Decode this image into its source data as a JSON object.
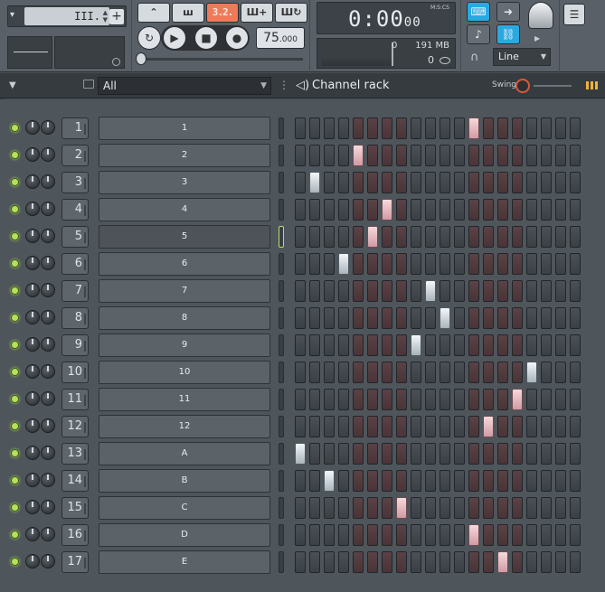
{
  "toolbar": {
    "pattern": {
      "label": "III.",
      "add_symbol": "+"
    },
    "transport": {
      "countdown_label": "3.2.",
      "tempo_int": "75",
      "tempo_dec": ".000"
    },
    "time": {
      "main": "0:00",
      "sub": "00",
      "unit": "M:S:CS"
    },
    "cpu": {
      "cpu_value": "0",
      "memory": "191 MB",
      "polyphony": "0"
    },
    "snap": {
      "value": "Line"
    }
  },
  "rack": {
    "filter": "All",
    "title": "Channel rack",
    "swing_label": "Swing"
  },
  "channels": [
    {
      "number": "1",
      "name": "1",
      "step_on": 12
    },
    {
      "number": "2",
      "name": "2",
      "step_on": 4
    },
    {
      "number": "3",
      "name": "3",
      "step_on": 1
    },
    {
      "number": "4",
      "name": "4",
      "step_on": 6
    },
    {
      "number": "5",
      "name": "5",
      "step_on": 5,
      "selected": true
    },
    {
      "number": "6",
      "name": "6",
      "step_on": 3
    },
    {
      "number": "7",
      "name": "7",
      "step_on": 9
    },
    {
      "number": "8",
      "name": "8",
      "step_on": 10
    },
    {
      "number": "9",
      "name": "9",
      "step_on": 8
    },
    {
      "number": "10",
      "name": "10",
      "step_on": 16
    },
    {
      "number": "11",
      "name": "11",
      "step_on": 15
    },
    {
      "number": "12",
      "name": "12",
      "step_on": 13
    },
    {
      "number": "13",
      "name": "A",
      "step_on": 0
    },
    {
      "number": "14",
      "name": "B",
      "step_on": 2
    },
    {
      "number": "15",
      "name": "C",
      "step_on": 7
    },
    {
      "number": "16",
      "name": "D",
      "step_on": 12
    },
    {
      "number": "17",
      "name": "E",
      "step_on": 14
    }
  ],
  "steps_per_pattern": 20,
  "colors": {
    "led": "#b6e05a",
    "accent": "#2aa9e0",
    "countdown": "#ef7a5a"
  }
}
